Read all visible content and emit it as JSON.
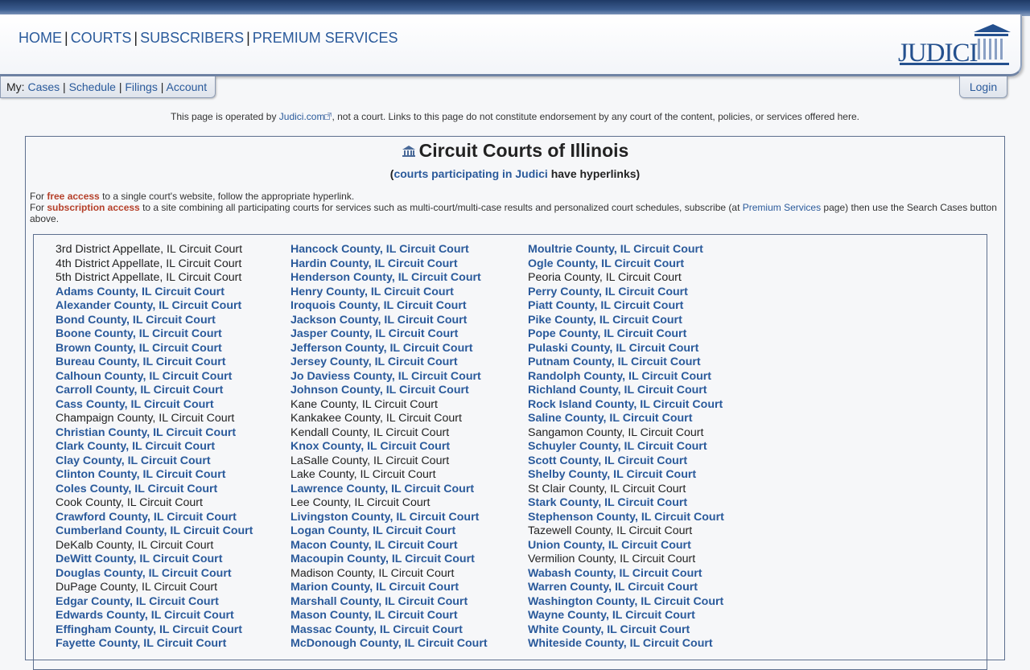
{
  "nav": {
    "items": [
      "HOME",
      "COURTS",
      "SUBSCRIBERS",
      "PREMIUM SERVICES"
    ],
    "separator": "|"
  },
  "logo": {
    "text": "JUDICI"
  },
  "mybar": {
    "prefix": "My:",
    "items": [
      "Cases",
      "Schedule",
      "Filings",
      "Account"
    ]
  },
  "login_label": "Login",
  "disclaimer": {
    "before": "This page is operated by ",
    "link": "Judici.com",
    "after": ", not a court. Links to this page do not constitute endorsement by any court of the content, policies, or services offered here."
  },
  "title": "Circuit Courts of Illinois",
  "subtitle": {
    "open": "(",
    "link": "courts participating in Judici",
    "rest": " have hyperlinks)"
  },
  "info": {
    "line1_a": "For ",
    "line1_red": "free access",
    "line1_b": " to a single court's website, follow the appropriate hyperlink.",
    "line2_a": "For ",
    "line2_red": "subscription access",
    "line2_b": " to a site combining all participating courts for services such as multi-court/multi-case results and personalized court schedules, subscribe (at ",
    "line2_link": "Premium Services",
    "line2_c": " page) then use the Search Cases button above."
  },
  "courts": {
    "col1": [
      {
        "name": "3rd District Appellate, IL Circuit Court",
        "link": false
      },
      {
        "name": "4th District Appellate, IL Circuit Court",
        "link": false
      },
      {
        "name": "5th District Appellate, IL Circuit Court",
        "link": false
      },
      {
        "name": "Adams County, IL Circuit Court",
        "link": true
      },
      {
        "name": "Alexander County, IL Circuit Court",
        "link": true
      },
      {
        "name": "Bond County, IL Circuit Court",
        "link": true
      },
      {
        "name": "Boone County, IL Circuit Court",
        "link": true
      },
      {
        "name": "Brown County, IL Circuit Court",
        "link": true
      },
      {
        "name": "Bureau County, IL Circuit Court",
        "link": true
      },
      {
        "name": "Calhoun County, IL Circuit Court",
        "link": true
      },
      {
        "name": "Carroll County, IL Circuit Court",
        "link": true
      },
      {
        "name": "Cass County, IL Circuit Court",
        "link": true
      },
      {
        "name": "Champaign County, IL Circuit Court",
        "link": false
      },
      {
        "name": "Christian County, IL Circuit Court",
        "link": true
      },
      {
        "name": "Clark County, IL Circuit Court",
        "link": true
      },
      {
        "name": "Clay County, IL Circuit Court",
        "link": true
      },
      {
        "name": "Clinton County, IL Circuit Court",
        "link": true
      },
      {
        "name": "Coles County, IL Circuit Court",
        "link": true
      },
      {
        "name": "Cook County, IL Circuit Court",
        "link": false
      },
      {
        "name": "Crawford County, IL Circuit Court",
        "link": true
      },
      {
        "name": "Cumberland County, IL Circuit Court",
        "link": true
      },
      {
        "name": "DeKalb County, IL Circuit Court",
        "link": false
      },
      {
        "name": "DeWitt County, IL Circuit Court",
        "link": true
      },
      {
        "name": "Douglas County, IL Circuit Court",
        "link": true
      },
      {
        "name": "DuPage County, IL Circuit Court",
        "link": false
      },
      {
        "name": "Edgar County, IL Circuit Court",
        "link": true
      },
      {
        "name": "Edwards County, IL Circuit Court",
        "link": true
      },
      {
        "name": "Effingham County, IL Circuit Court",
        "link": true
      },
      {
        "name": "Fayette County, IL Circuit Court",
        "link": true
      }
    ],
    "col2": [
      {
        "name": "Hancock County, IL Circuit Court",
        "link": true
      },
      {
        "name": "Hardin County, IL Circuit Court",
        "link": true
      },
      {
        "name": "Henderson County, IL Circuit Court",
        "link": true
      },
      {
        "name": "Henry County, IL Circuit Court",
        "link": true
      },
      {
        "name": "Iroquois County, IL Circuit Court",
        "link": true
      },
      {
        "name": "Jackson County, IL Circuit Court",
        "link": true
      },
      {
        "name": "Jasper County, IL Circuit Court",
        "link": true
      },
      {
        "name": "Jefferson County, IL Circuit Court",
        "link": true
      },
      {
        "name": "Jersey County, IL Circuit Court",
        "link": true
      },
      {
        "name": "Jo Daviess County, IL Circuit Court",
        "link": true
      },
      {
        "name": "Johnson County, IL Circuit Court",
        "link": true
      },
      {
        "name": "Kane County, IL Circuit Court",
        "link": false
      },
      {
        "name": "Kankakee County, IL Circuit Court",
        "link": false
      },
      {
        "name": "Kendall County, IL Circuit Court",
        "link": false
      },
      {
        "name": "Knox County, IL Circuit Court",
        "link": true
      },
      {
        "name": "LaSalle County, IL Circuit Court",
        "link": false
      },
      {
        "name": "Lake County, IL Circuit Court",
        "link": false
      },
      {
        "name": "Lawrence County, IL Circuit Court",
        "link": true
      },
      {
        "name": "Lee County, IL Circuit Court",
        "link": false
      },
      {
        "name": "Livingston County, IL Circuit Court",
        "link": true
      },
      {
        "name": "Logan County, IL Circuit Court",
        "link": true
      },
      {
        "name": "Macon County, IL Circuit Court",
        "link": true
      },
      {
        "name": "Macoupin County, IL Circuit Court",
        "link": true
      },
      {
        "name": "Madison County, IL Circuit Court",
        "link": false
      },
      {
        "name": "Marion County, IL Circuit Court",
        "link": true
      },
      {
        "name": "Marshall County, IL Circuit Court",
        "link": true
      },
      {
        "name": "Mason County, IL Circuit Court",
        "link": true
      },
      {
        "name": "Massac County, IL Circuit Court",
        "link": true
      },
      {
        "name": "McDonough County, IL Circuit Court",
        "link": true
      }
    ],
    "col3": [
      {
        "name": "Moultrie County, IL Circuit Court",
        "link": true
      },
      {
        "name": "Ogle County, IL Circuit Court",
        "link": true
      },
      {
        "name": "Peoria County, IL Circuit Court",
        "link": false
      },
      {
        "name": "Perry County, IL Circuit Court",
        "link": true
      },
      {
        "name": "Piatt County, IL Circuit Court",
        "link": true
      },
      {
        "name": "Pike County, IL Circuit Court",
        "link": true
      },
      {
        "name": "Pope County, IL Circuit Court",
        "link": true
      },
      {
        "name": "Pulaski County, IL Circuit Court",
        "link": true
      },
      {
        "name": "Putnam County, IL Circuit Court",
        "link": true
      },
      {
        "name": "Randolph County, IL Circuit Court",
        "link": true
      },
      {
        "name": "Richland County, IL Circuit Court",
        "link": true
      },
      {
        "name": "Rock Island County, IL Circuit Court",
        "link": true
      },
      {
        "name": "Saline County, IL Circuit Court",
        "link": true
      },
      {
        "name": "Sangamon County, IL Circuit Court",
        "link": false
      },
      {
        "name": "Schuyler County, IL Circuit Court",
        "link": true
      },
      {
        "name": "Scott County, IL Circuit Court",
        "link": true
      },
      {
        "name": "Shelby County, IL Circuit Court",
        "link": true
      },
      {
        "name": "St Clair County, IL Circuit Court",
        "link": false
      },
      {
        "name": "Stark County, IL Circuit Court",
        "link": true
      },
      {
        "name": "Stephenson County, IL Circuit Court",
        "link": true
      },
      {
        "name": "Tazewell County, IL Circuit Court",
        "link": false
      },
      {
        "name": "Union County, IL Circuit Court",
        "link": true
      },
      {
        "name": "Vermilion County, IL Circuit Court",
        "link": false
      },
      {
        "name": "Wabash County, IL Circuit Court",
        "link": true
      },
      {
        "name": "Warren County, IL Circuit Court",
        "link": true
      },
      {
        "name": "Washington County, IL Circuit Court",
        "link": true
      },
      {
        "name": "Wayne County, IL Circuit Court",
        "link": true
      },
      {
        "name": "White County, IL Circuit Court",
        "link": true
      },
      {
        "name": "Whiteside County, IL Circuit Court",
        "link": true
      }
    ]
  },
  "colors": {
    "link": "#2a5a9b",
    "accent_red": "#b5402a",
    "border": "#5d6f8e",
    "background": "#f6f7f9"
  }
}
